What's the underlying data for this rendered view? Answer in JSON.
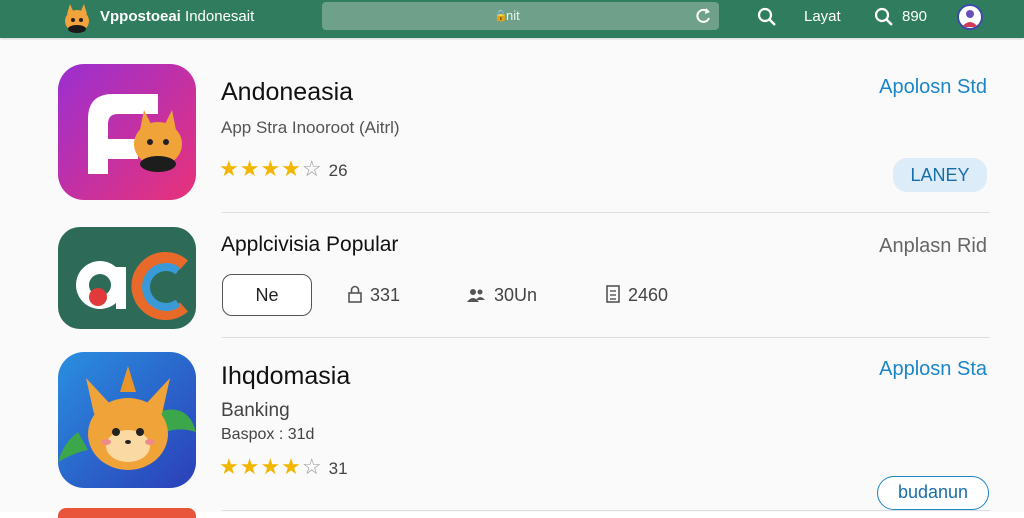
{
  "header": {
    "store_name_bold": "Vppostoeai",
    "store_name_rest": "Indonesait",
    "address_text": "nit",
    "nav_label": "Layat",
    "counter": "890"
  },
  "apps": [
    {
      "title": "Andoneasia",
      "subtitle": "App Stra  Inooroot (Aitrl)",
      "rating": 4,
      "rating_count": "26",
      "vendor": "Apolosn Std",
      "vendor_color": "#1a86c8",
      "action_label": "LANEY"
    },
    {
      "title": "Applcivisia Popular",
      "vendor": "Anplasn Rid",
      "vendor_color": "#666666",
      "button_label": "Ne",
      "metrics": [
        {
          "icon": "lock-icon",
          "value": "331"
        },
        {
          "icon": "users-icon",
          "value": "30Un"
        },
        {
          "icon": "document-icon",
          "value": "2460"
        }
      ]
    },
    {
      "title": "Ihqdomasia",
      "category": "Banking",
      "extra": "Baspox : 31d",
      "rating": 4,
      "rating_count": "31",
      "vendor": "Applosn Sta",
      "vendor_color": "#1a86c8",
      "action_label": "budanun"
    }
  ],
  "colors": {
    "header_bg": "#2f7d5e",
    "accent_blue": "#1a86c8",
    "star": "#f2b600"
  }
}
